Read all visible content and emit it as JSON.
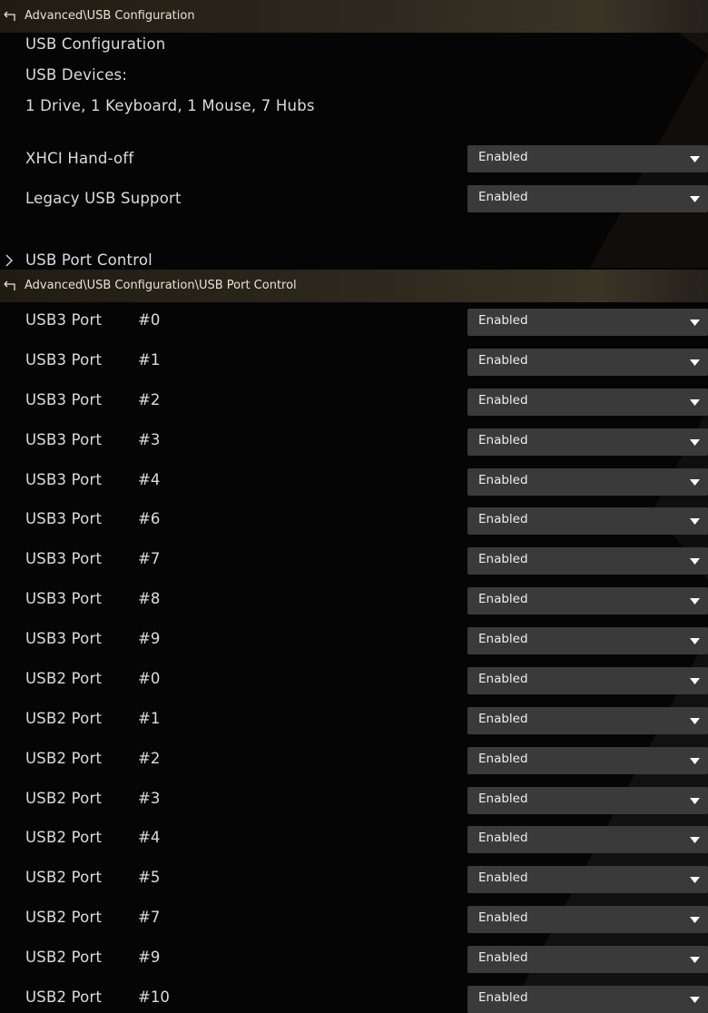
{
  "top_section": {
    "breadcrumb": "Advanced\\USB Configuration",
    "title": "USB Configuration",
    "devices_label": "USB Devices:",
    "devices_value": "1 Drive, 1 Keyboard, 1 Mouse, 7 Hubs",
    "settings": [
      {
        "label": "XHCI Hand-off",
        "value": "Enabled"
      },
      {
        "label": "Legacy USB Support",
        "value": "Enabled"
      }
    ],
    "submenu_label": "USB Port Control"
  },
  "port_section": {
    "breadcrumb": "Advanced\\USB Configuration\\USB Port Control",
    "ports": [
      {
        "type": "USB3 Port",
        "num": "#0",
        "value": "Enabled"
      },
      {
        "type": "USB3 Port",
        "num": "#1",
        "value": "Enabled"
      },
      {
        "type": "USB3 Port",
        "num": "#2",
        "value": "Enabled"
      },
      {
        "type": "USB3 Port",
        "num": "#3",
        "value": "Enabled"
      },
      {
        "type": "USB3 Port",
        "num": "#4",
        "value": "Enabled"
      },
      {
        "type": "USB3 Port",
        "num": "#6",
        "value": "Enabled"
      },
      {
        "type": "USB3 Port",
        "num": "#7",
        "value": "Enabled"
      },
      {
        "type": "USB3 Port",
        "num": "#8",
        "value": "Enabled"
      },
      {
        "type": "USB3 Port",
        "num": "#9",
        "value": "Enabled"
      },
      {
        "type": "USB2 Port",
        "num": "#0",
        "value": "Enabled"
      },
      {
        "type": "USB2 Port",
        "num": "#1",
        "value": "Enabled"
      },
      {
        "type": "USB2 Port",
        "num": "#2",
        "value": "Enabled"
      },
      {
        "type": "USB2 Port",
        "num": "#3",
        "value": "Enabled"
      },
      {
        "type": "USB2 Port",
        "num": "#4",
        "value": "Enabled"
      },
      {
        "type": "USB2 Port",
        "num": "#5",
        "value": "Enabled"
      },
      {
        "type": "USB2 Port",
        "num": "#7",
        "value": "Enabled"
      },
      {
        "type": "USB2 Port",
        "num": "#9",
        "value": "Enabled"
      },
      {
        "type": "USB2 Port",
        "num": "#10",
        "value": "Enabled"
      }
    ]
  },
  "colors": {
    "background": "#050505",
    "dropdown_bg": "#3a3a3a",
    "breadcrumb_bar": "#2e291e",
    "text": "#dcdcdc"
  }
}
